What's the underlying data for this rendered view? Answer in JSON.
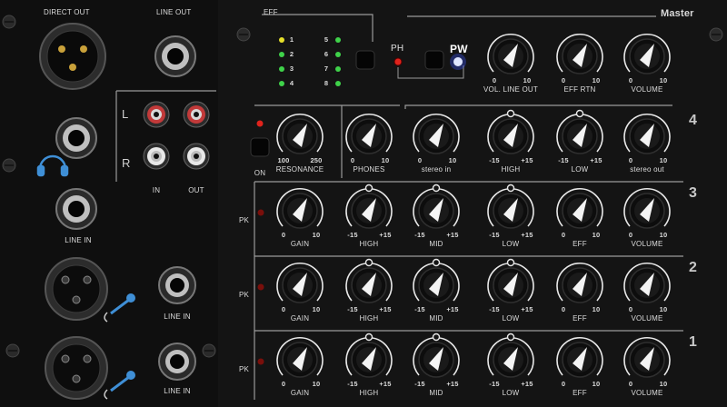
{
  "sections": {
    "direct_out": "DIRECT OUT",
    "line_out": "LINE OUT",
    "eff": "EFF",
    "master": "Master",
    "ph": "PH",
    "pw": "PW"
  },
  "left": {
    "rca_l": "L",
    "rca_r": "R",
    "rca_in": "IN",
    "rca_out": "OUT",
    "line_in_1": "LINE IN",
    "line_in_2": "LINE IN",
    "line_in_3": "LINE IN"
  },
  "eff_leds": [
    "1",
    "2",
    "3",
    "4",
    "5",
    "6",
    "7",
    "8"
  ],
  "master_knobs": [
    {
      "label": "VOL. LINE OUT",
      "min": "0",
      "max": "10"
    },
    {
      "label": "EFF RTN",
      "min": "0",
      "max": "10"
    },
    {
      "label": "VOLUME",
      "min": "0",
      "max": "10"
    }
  ],
  "ch4": {
    "num": "4",
    "on": "ON",
    "resonance": {
      "label": "RESONANCE",
      "min": "100",
      "max": "250"
    },
    "phones": {
      "label": "PHONES",
      "min": "0",
      "max": "10"
    },
    "stereo_in": {
      "label": "stereo in",
      "min": "0",
      "max": "10"
    },
    "high": {
      "label": "HIGH",
      "min": "-15",
      "max": "+15"
    },
    "low": {
      "label": "LOW",
      "min": "-15",
      "max": "+15"
    },
    "stereo_out": {
      "label": "stereo out",
      "min": "0",
      "max": "10"
    }
  },
  "channels": [
    {
      "num": "3",
      "pk": "PK",
      "knobs": [
        {
          "label": "GAIN",
          "min": "0",
          "max": "10"
        },
        {
          "label": "HIGH",
          "min": "-15",
          "max": "+15"
        },
        {
          "label": "MID",
          "min": "-15",
          "max": "+15"
        },
        {
          "label": "LOW",
          "min": "-15",
          "max": "+15"
        },
        {
          "label": "EFF",
          "min": "0",
          "max": "10"
        },
        {
          "label": "VOLUME",
          "min": "0",
          "max": "10"
        }
      ]
    },
    {
      "num": "2",
      "pk": "PK",
      "knobs": [
        {
          "label": "GAIN",
          "min": "0",
          "max": "10"
        },
        {
          "label": "HIGH",
          "min": "-15",
          "max": "+15"
        },
        {
          "label": "MID",
          "min": "-15",
          "max": "+15"
        },
        {
          "label": "LOW",
          "min": "-15",
          "max": "+15"
        },
        {
          "label": "EFF",
          "min": "0",
          "max": "10"
        },
        {
          "label": "VOLUME",
          "min": "0",
          "max": "10"
        }
      ]
    },
    {
      "num": "1",
      "pk": "PK",
      "knobs": [
        {
          "label": "GAIN",
          "min": "0",
          "max": "10"
        },
        {
          "label": "HIGH",
          "min": "-15",
          "max": "+15"
        },
        {
          "label": "MID",
          "min": "-15",
          "max": "+15"
        },
        {
          "label": "LOW",
          "min": "-15",
          "max": "+15"
        },
        {
          "label": "EFF",
          "min": "0",
          "max": "10"
        },
        {
          "label": "VOLUME",
          "min": "0",
          "max": "10"
        }
      ]
    }
  ],
  "colors": {
    "led_green": "#3fd24a",
    "led_yellow": "#e6e02a",
    "led_red": "#e0231c",
    "led_blue": "#5b7bff"
  }
}
